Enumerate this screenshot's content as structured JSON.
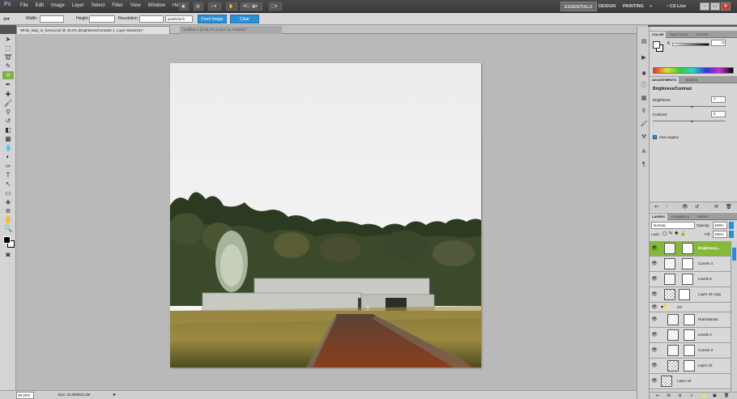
{
  "app": {
    "logo": "Ps",
    "menus": [
      "File",
      "Edit",
      "Image",
      "Layer",
      "Select",
      "Filter",
      "View",
      "Window",
      "Help"
    ],
    "zoom_readout": "40,3",
    "workspaces": [
      "ESSENTIALS",
      "DESIGN",
      "PAINTING"
    ],
    "more": "»",
    "cs_live": "CS Live"
  },
  "options": {
    "width_label": "Width:",
    "height_label": "Height:",
    "resolution_label": "Resolution:",
    "unit": "pixels/inch",
    "front_image": "Front Image",
    "clear": "Clear"
  },
  "tabs": [
    {
      "label": "White_lady_in_forest.psd @ 40,3% (Brightness/Contrast 1, Layer Mask/16) *"
    },
    {
      "label": "Untitled-1 @ 66,7% (Layer 11, RGB/8) *"
    }
  ],
  "status": {
    "zoom": "40,20%",
    "doc": "Doc: 22,4M/812,1M"
  },
  "panels": {
    "color_tabs": [
      "COLOR",
      "SWATCHES",
      "STYLES"
    ],
    "color_value": "0",
    "adjust_tabs": [
      "ADJUSTMENTS",
      "MASKS"
    ],
    "adjust_title": "Brightness/Contrast",
    "brightness_label": "Brightness:",
    "brightness_value": "7",
    "contrast_label": "Contrast:",
    "contrast_value": "5",
    "use_legacy": "Use Legacy",
    "layers_tabs": [
      "LAYERS",
      "CHANNELS",
      "PATHS"
    ],
    "blend_mode": "Normal",
    "opacity_label": "Opacity:",
    "opacity_value": "100%",
    "lock_label": "Lock:",
    "fill_label": "Fill:",
    "fill_value": "100%"
  },
  "layers": [
    {
      "name": "Brightness...",
      "selected": true,
      "type": "adj"
    },
    {
      "name": "Curves 4",
      "type": "adj"
    },
    {
      "name": "Levels 5",
      "type": "adj"
    },
    {
      "name": "Layer 23 copy",
      "type": "pixel"
    },
    {
      "name": "Grl",
      "type": "group"
    },
    {
      "name": "Hue/Saturat...",
      "type": "adj"
    },
    {
      "name": "Levels 4",
      "type": "adj"
    },
    {
      "name": "Curves 3",
      "type": "adj"
    },
    {
      "name": "Layer 23",
      "type": "pixel"
    },
    {
      "name": "Layer 24",
      "type": "pixel"
    }
  ],
  "colors": {
    "accent_blue": "#2b8fd6",
    "selected_layer": "#86b83a"
  }
}
